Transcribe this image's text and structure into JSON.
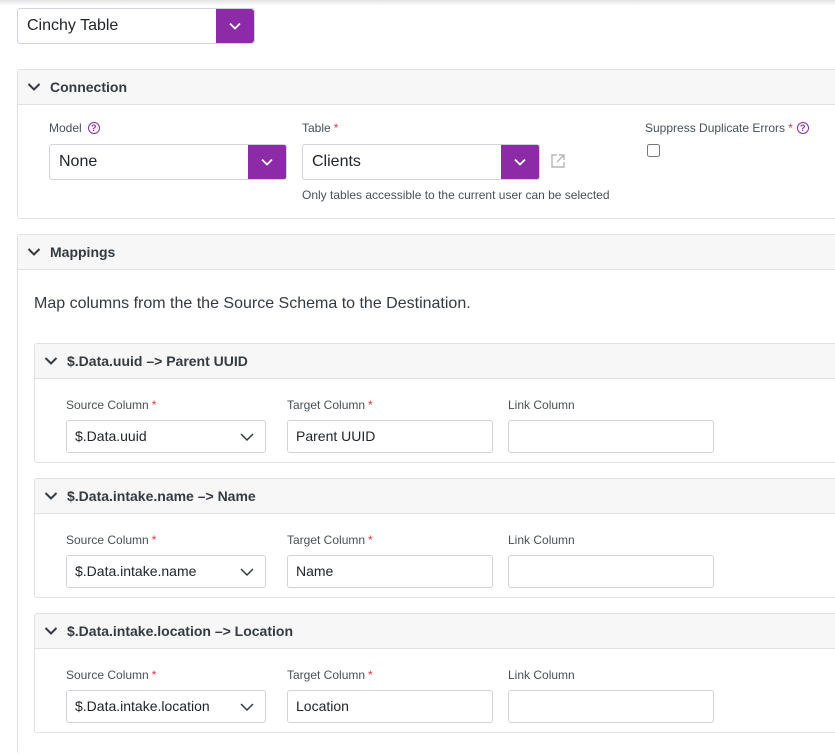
{
  "destination": {
    "type_value": "Cinchy Table"
  },
  "connection": {
    "title": "Connection",
    "model_label": "Model",
    "model_value": "None",
    "table_label": "Table",
    "table_value": "Clients",
    "table_hint": "Only tables accessible to the current user can be selected",
    "suppress_label": "Suppress Duplicate Errors",
    "suppress_checked": false
  },
  "mappings": {
    "title": "Mappings",
    "description": "Map columns from the the Source Schema to the Destination.",
    "source_label": "Source Column",
    "target_label": "Target Column",
    "link_label": "Link Column",
    "items": [
      {
        "title": "$.Data.uuid –> Parent UUID",
        "source": "$.Data.uuid",
        "target": "Parent UUID",
        "link": ""
      },
      {
        "title": "$.Data.intake.name –> Name",
        "source": "$.Data.intake.name",
        "target": "Name",
        "link": ""
      },
      {
        "title": "$.Data.intake.location –> Location",
        "source": "$.Data.intake.location",
        "target": "Location",
        "link": ""
      }
    ]
  },
  "colors": {
    "accent": "#8d2aa8",
    "required": "#dc3545"
  }
}
